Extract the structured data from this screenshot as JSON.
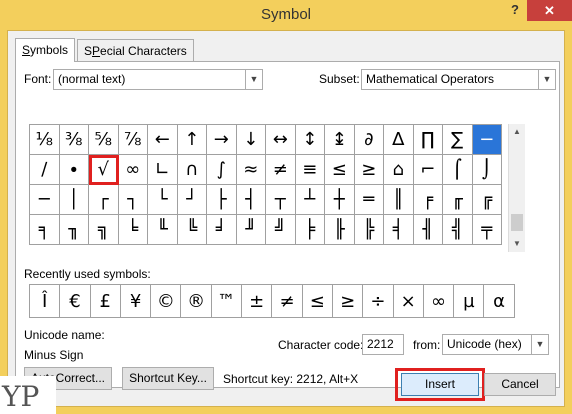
{
  "window": {
    "title": "Symbol",
    "help": "?",
    "close": "✕"
  },
  "tabs": [
    {
      "label": "Symbols",
      "mnemonic": "S",
      "rest": "ymbols"
    },
    {
      "label": "Special Characters",
      "mnemonic": "P",
      "pre": "S",
      "rest": "ecial Characters"
    }
  ],
  "font": {
    "label": "Font:",
    "value": "(normal text)"
  },
  "subset": {
    "label": "Subset:",
    "value": "Mathematical Operators"
  },
  "symbol_grid": [
    [
      "⅛",
      "⅜",
      "⅝",
      "⅞",
      "←",
      "↑",
      "→",
      "↓",
      "↔",
      "↕",
      "↨",
      "∂",
      "∆",
      "∏",
      "∑",
      "−"
    ],
    [
      "∕",
      "∙",
      "√",
      "∞",
      "∟",
      "∩",
      "∫",
      "≈",
      "≠",
      "≡",
      "≤",
      "≥",
      "⌂",
      "⌐",
      "⌠",
      "⌡"
    ],
    [
      "─",
      "│",
      "┌",
      "┐",
      "└",
      "┘",
      "├",
      "┤",
      "┬",
      "┴",
      "┼",
      "═",
      "║",
      "╒",
      "╓",
      "╔"
    ],
    [
      "╕",
      "╖",
      "╗",
      "╘",
      "╙",
      "╚",
      "╛",
      "╜",
      "╝",
      "╞",
      "╟",
      "╠",
      "╡",
      "╢",
      "╣",
      "╤"
    ]
  ],
  "recently_used": {
    "label": "Recently used symbols:",
    "symbols": [
      "Î",
      "€",
      "£",
      "¥",
      "©",
      "®",
      "™",
      "±",
      "≠",
      "≤",
      "≥",
      "÷",
      "×",
      "∞",
      "µ",
      "α"
    ]
  },
  "unicode": {
    "name_label": "Unicode name:",
    "name_value": "Minus Sign"
  },
  "character_code": {
    "label": "Character code:",
    "value": "2212"
  },
  "from": {
    "label": "from:",
    "value": "Unicode (hex)"
  },
  "buttons": {
    "autocorrect": "AutoCorrect...",
    "shortcut_key": "Shortcut Key...",
    "insert": "Insert",
    "cancel": "Cancel"
  },
  "shortcut_text": "Shortcut key: 2212, Alt+X",
  "logo_text": "YP",
  "colors": {
    "accent": "#2a75d8",
    "highlight": "#e0201f",
    "titlebar": "#f3cf5c",
    "close": "#c7403c"
  }
}
